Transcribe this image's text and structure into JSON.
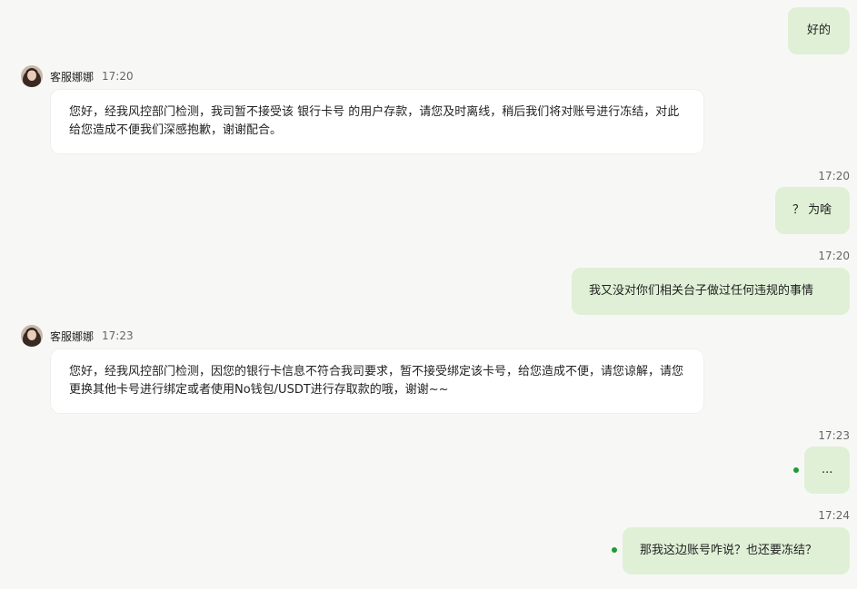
{
  "colors": {
    "page_bg": "#f7f8f6",
    "outgoing_bubble": "#dff0d6",
    "incoming_bubble": "#ffffff",
    "status_dot": "#1f9a34"
  },
  "messages": {
    "m1": {
      "text": "好的"
    },
    "m2": {
      "sender": "客服娜娜",
      "time": "17:20",
      "text": "您好，经我风控部门检测，我司暂不接受该 银行卡号 的用户存款，请您及时离线，稍后我们将对账号进行冻结，对此给您造成不便我们深感抱歉，谢谢配合。"
    },
    "m3": {
      "time": "17:20",
      "text": "？ 为啥"
    },
    "m4": {
      "time": "17:20",
      "text": "我又没对你们相关台子做过任何违规的事情"
    },
    "m5": {
      "sender": "客服娜娜",
      "time": "17:23",
      "text": "您好，经我风控部门检测，因您的银行卡信息不符合我司要求，暂不接受绑定该卡号，给您造成不便，请您谅解，请您更换其他卡号进行绑定或者使用No钱包/USDT进行存取款的哦，谢谢~~"
    },
    "m6": {
      "time": "17:23",
      "text": "..."
    },
    "m7": {
      "time": "17:24",
      "text": "那我这边账号咋说？也还要冻结？"
    }
  }
}
